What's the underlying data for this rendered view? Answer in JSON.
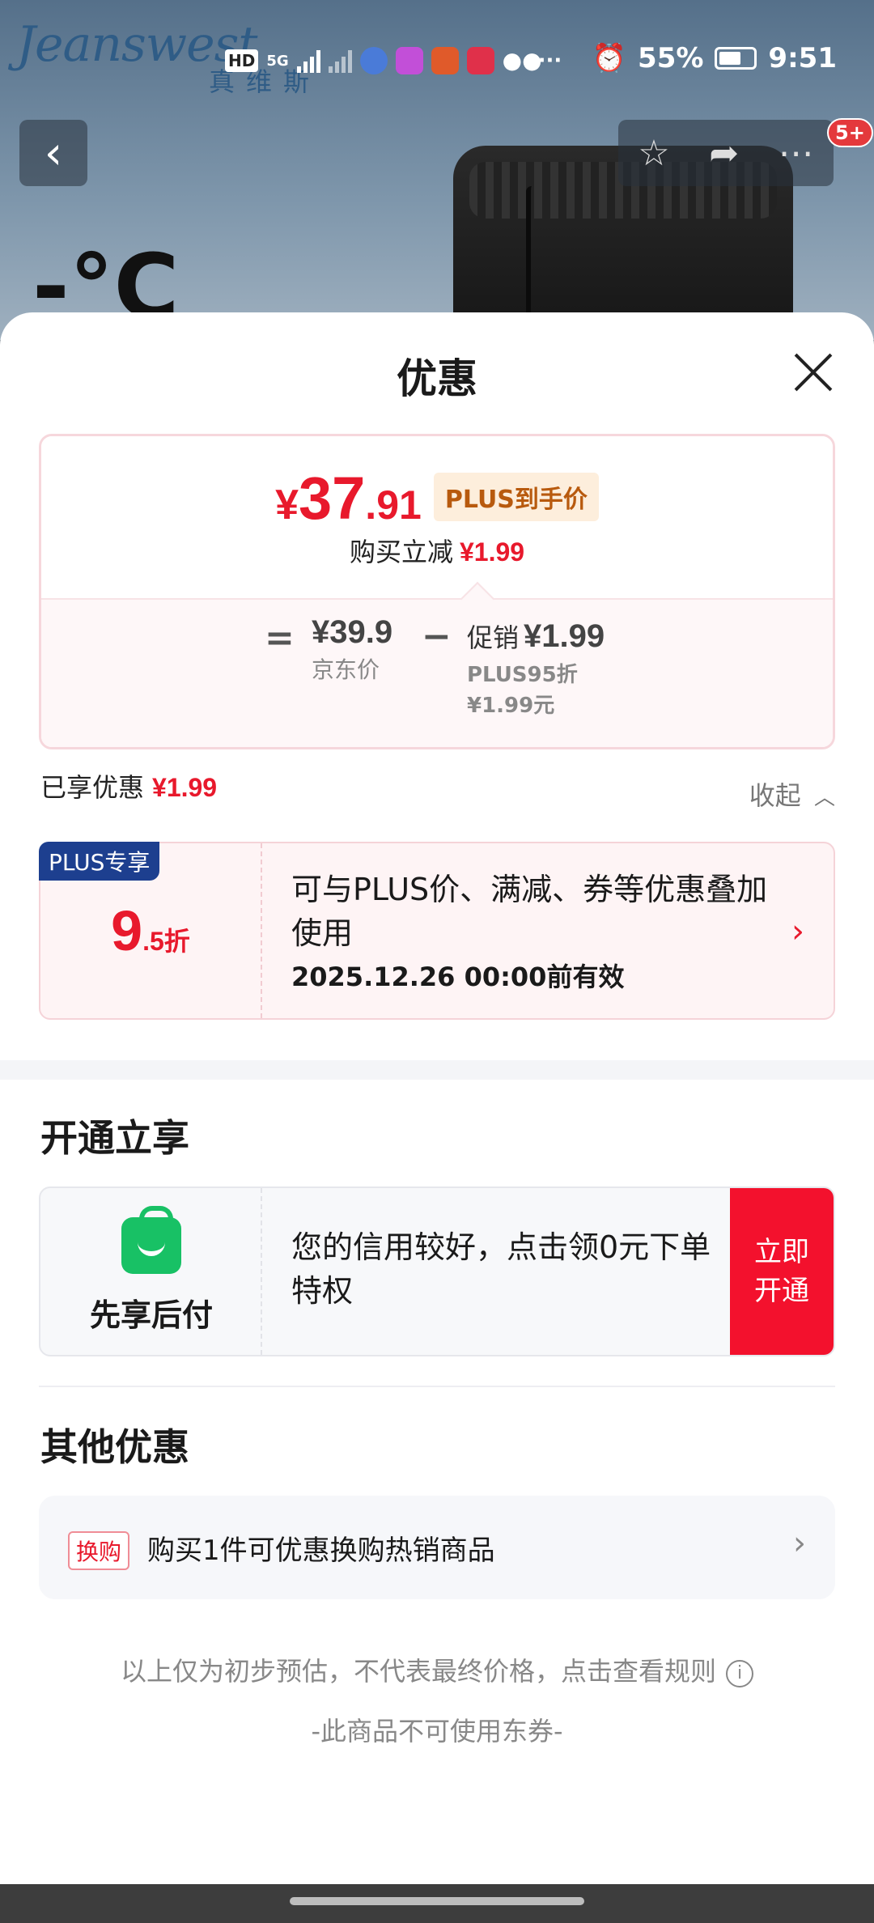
{
  "product_bg": {
    "brand": "Jeanswest",
    "brand_sub": "真维斯",
    "temp_text": "-°C"
  },
  "status_bar": {
    "hd_label": "HD",
    "network": "5G",
    "battery": "55%",
    "time": "9:51"
  },
  "nav": {
    "back_icon": "chevron-left-icon",
    "badge": "5+"
  },
  "sheet": {
    "title": "优惠"
  },
  "price_card": {
    "currency": "¥",
    "price_int": "37",
    "price_dec": ".91",
    "plus_tag": "PLUS到手价",
    "reduce_label": "购买立减",
    "reduce_value": "¥1.99",
    "eq": "=",
    "jd_price": "¥39.9",
    "jd_label": "京东价",
    "minus": "−",
    "promo_label": "促销",
    "promo_value": "¥1.99",
    "promo_sub1": "PLUS95折",
    "promo_sub2": "¥1.99元"
  },
  "enjoyed": {
    "label": "已享优惠",
    "value": "¥1.99",
    "collapse_label": "收起"
  },
  "plus_coupon": {
    "tag": "PLUS专享",
    "discount_big": "9",
    "discount_small": ".5折",
    "desc": "可与PLUS价、满减、券等优惠叠加使用",
    "date": "2025.12.26 00:00前有效"
  },
  "open_section": {
    "title": "开通立享",
    "bnpl_label": "先享后付",
    "bnpl_desc": "您的信用较好，点击领0元下单特权",
    "button": "立即开通"
  },
  "other_section": {
    "title": "其他优惠",
    "tag": "换购",
    "text": "购买1件可优惠换购热销商品"
  },
  "footer": {
    "disclaimer": "以上仅为初步预估，不代表最终价格，点击查看规则",
    "no_coupon": "-此商品不可使用东券-"
  },
  "colors": {
    "accent_red": "#e8192c",
    "plus_blue": "#1d3f8f",
    "bnpl_green": "#18c165"
  }
}
